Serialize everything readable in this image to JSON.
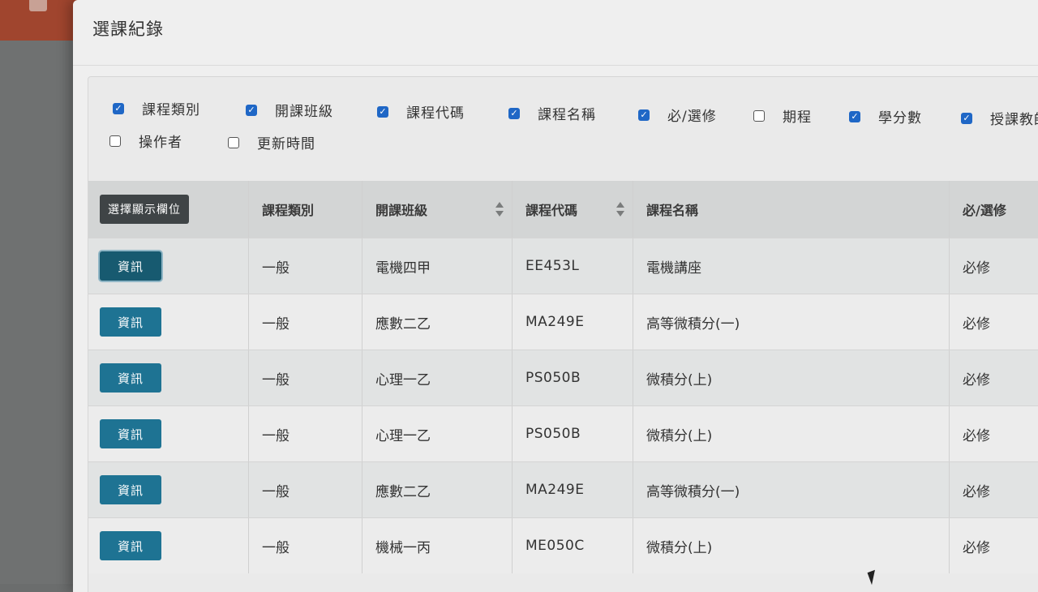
{
  "modal": {
    "title": "選課紀錄"
  },
  "column_toggles": [
    {
      "label": "課程類別",
      "checked": true
    },
    {
      "label": "開課班級",
      "checked": true
    },
    {
      "label": "課程代碼",
      "checked": true
    },
    {
      "label": "課程名稱",
      "checked": true
    },
    {
      "label": "必/選修",
      "checked": true
    },
    {
      "label": "期程",
      "checked": false
    },
    {
      "label": "學分數",
      "checked": true
    },
    {
      "label": "授課教師",
      "checked": true
    },
    {
      "label": "操作者",
      "checked": false
    },
    {
      "label": "更新時間",
      "checked": false
    }
  ],
  "table": {
    "show_columns_label": "選擇顯示欄位",
    "headers": [
      "課程類別",
      "開課班級",
      "課程代碼",
      "課程名稱",
      "必/選修"
    ],
    "info_label": "資訊",
    "rows": [
      {
        "category": "一般",
        "class": "電機四甲",
        "code": "EE453L",
        "name": "電機講座",
        "type": "必修"
      },
      {
        "category": "一般",
        "class": "應數二乙",
        "code": "MA249E",
        "name": "高等微積分(一)",
        "type": "必修"
      },
      {
        "category": "一般",
        "class": "心理一乙",
        "code": "PS050B",
        "name": "微積分(上)",
        "type": "必修"
      },
      {
        "category": "一般",
        "class": "心理一乙",
        "code": "PS050B",
        "name": "微積分(上)",
        "type": "必修"
      },
      {
        "category": "一般",
        "class": "應數二乙",
        "code": "MA249E",
        "name": "高等微積分(一)",
        "type": "必修"
      },
      {
        "category": "一般",
        "class": "機械一丙",
        "code": "ME050C",
        "name": "微積分(上)",
        "type": "必修"
      }
    ]
  },
  "colors": {
    "checkbox_on": "#1f67c6",
    "info_button": "#1e7393",
    "show_columns_button": "#3f4446",
    "topbar": "#a0452e"
  }
}
